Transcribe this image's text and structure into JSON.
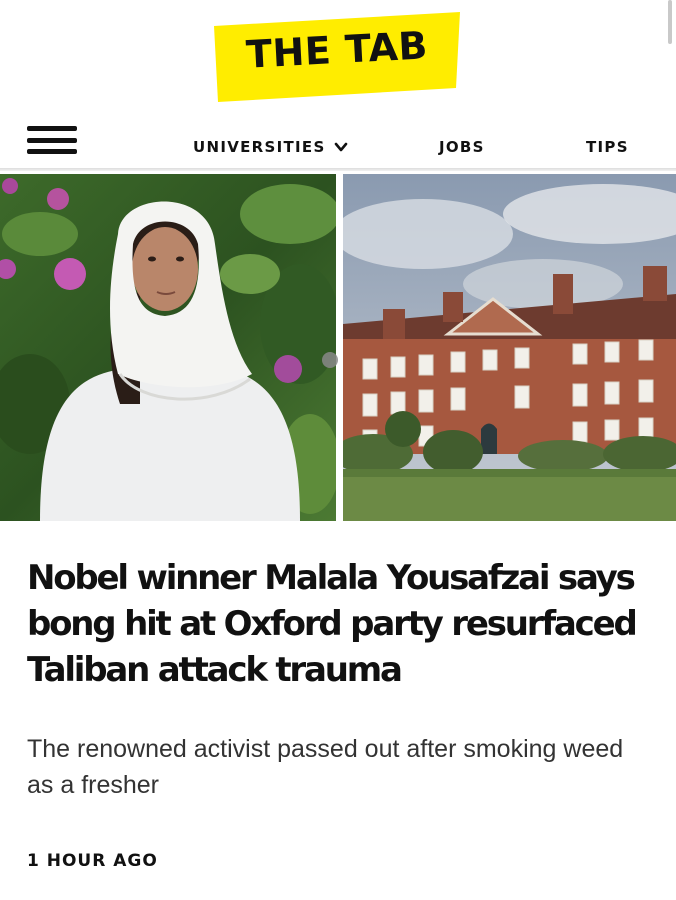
{
  "header": {
    "logo_text": "THE TAB",
    "logo_color": "#ffed00"
  },
  "nav": {
    "menu_icon": "hamburger-menu-icon",
    "items": [
      {
        "label": "UNIVERSITIES",
        "has_dropdown": true,
        "dropdown_icon": "chevron-down-icon"
      },
      {
        "label": "JOBS"
      },
      {
        "label": "TIPS"
      }
    ]
  },
  "article": {
    "images": [
      {
        "subject": "Malala Yousafzai portrait"
      },
      {
        "subject": "Oxford college building"
      }
    ],
    "headline": "Nobel winner Malala Yousafzai says bong hit at Oxford party resurfaced Taliban attack trauma",
    "subheadline": "The renowned activist passed out after smoking weed as a fresher",
    "timestamp": "1 HOUR AGO"
  }
}
